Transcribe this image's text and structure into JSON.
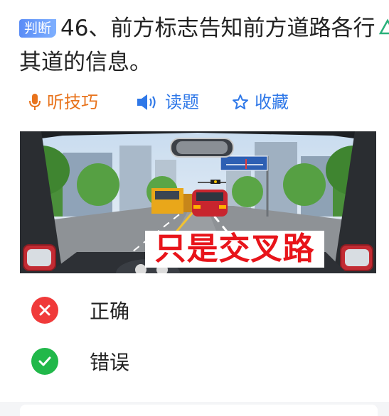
{
  "question": {
    "type_badge": "判断",
    "number": "46、",
    "text": "前方标志告知前方道路各行其道的信息。"
  },
  "toolbar": {
    "listen_label": "听技巧",
    "read_label": "读题",
    "favorite_label": "收藏"
  },
  "image": {
    "overlay_text": "只是交叉路"
  },
  "options": [
    {
      "label": "正确",
      "status": "wrong",
      "icon": "cross-icon",
      "color": "#f03a3a"
    },
    {
      "label": "错误",
      "status": "correct",
      "icon": "check-icon",
      "color": "#21b84a"
    }
  ],
  "colors": {
    "badge": "#5a8cf6",
    "accent_orange": "#e8731c",
    "accent_blue": "#2f78e8"
  }
}
